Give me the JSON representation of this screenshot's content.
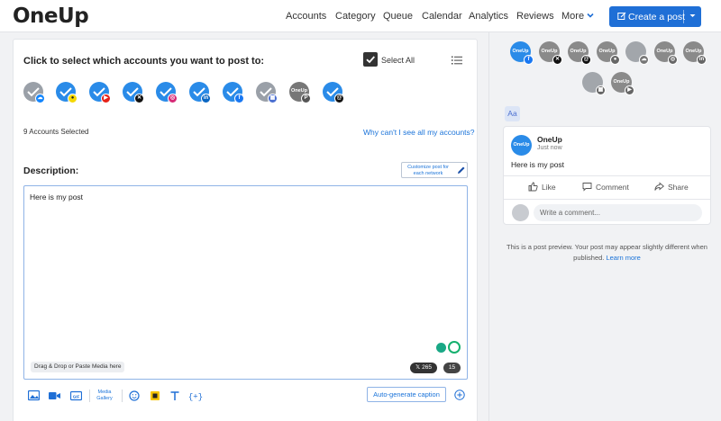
{
  "app": {
    "logo": "OneUp"
  },
  "nav": {
    "items": [
      "Accounts",
      "Category",
      "Queue",
      "Calendar",
      "Analytics",
      "Reviews"
    ],
    "more": "More",
    "create_post": "Create a post"
  },
  "account_select": {
    "title": "Click to select which accounts you want to post to:",
    "select_all_label": "Select All",
    "select_all_checked": true,
    "accounts": [
      {
        "kind": "photo",
        "network": "bluesky"
      },
      {
        "kind": "check",
        "network": "snapchat"
      },
      {
        "kind": "check",
        "network": "youtube"
      },
      {
        "kind": "check",
        "network": "x"
      },
      {
        "kind": "check",
        "network": "instagram"
      },
      {
        "kind": "check",
        "network": "linkedin"
      },
      {
        "kind": "check",
        "network": "facebook"
      },
      {
        "kind": "photo",
        "network": "google-business"
      },
      {
        "kind": "oneup",
        "network": "pinterest",
        "label": "OneUp"
      },
      {
        "kind": "check",
        "network": "threads"
      }
    ],
    "selected_count": "9 Accounts Selected",
    "why_link": "Why can't I see all my accounts?"
  },
  "description": {
    "label": "Description:",
    "customize_btn": "Customize post for each network",
    "text": "Here is my post",
    "drop_hint": "Drag & Drop or Paste Media here",
    "x_count": "265",
    "other_count": "15"
  },
  "toolbar": {
    "media_gallery": "Media Gallery",
    "auto_caption": "Auto-generate caption"
  },
  "preview": {
    "avatars": [
      {
        "kind": "blue",
        "network": "facebook",
        "label": "OneUp"
      },
      {
        "kind": "gray",
        "network": "x",
        "label": "OneUp"
      },
      {
        "kind": "gray",
        "network": "threads",
        "label": "OneUp"
      },
      {
        "kind": "gray",
        "network": "snapchat",
        "label": "OneUp"
      },
      {
        "kind": "photo",
        "network": "bluesky",
        "label": ""
      },
      {
        "kind": "gray",
        "network": "instagram",
        "label": "OneUp"
      },
      {
        "kind": "gray",
        "network": "linkedin",
        "label": "OneUp"
      },
      {
        "kind": "photo",
        "network": "google-business",
        "label": ""
      },
      {
        "kind": "gray",
        "network": "youtube",
        "label": "OneUp"
      }
    ],
    "font_toggle": "Aa",
    "card": {
      "avatar_label": "OneUp",
      "page_name": "OneUp",
      "time": "Just now",
      "text": "Here is my post",
      "like": "Like",
      "comment": "Comment",
      "share": "Share",
      "comment_placeholder": "Write a comment..."
    },
    "note": "This is a post preview. Your post may appear slightly different when published.",
    "learn_more": "Learn more"
  },
  "colors": {
    "primary": "#1f6fd6",
    "link": "#1a73d9",
    "avatar_blue": "#2a8be8",
    "avatar_gray": "#8a8a8a"
  }
}
